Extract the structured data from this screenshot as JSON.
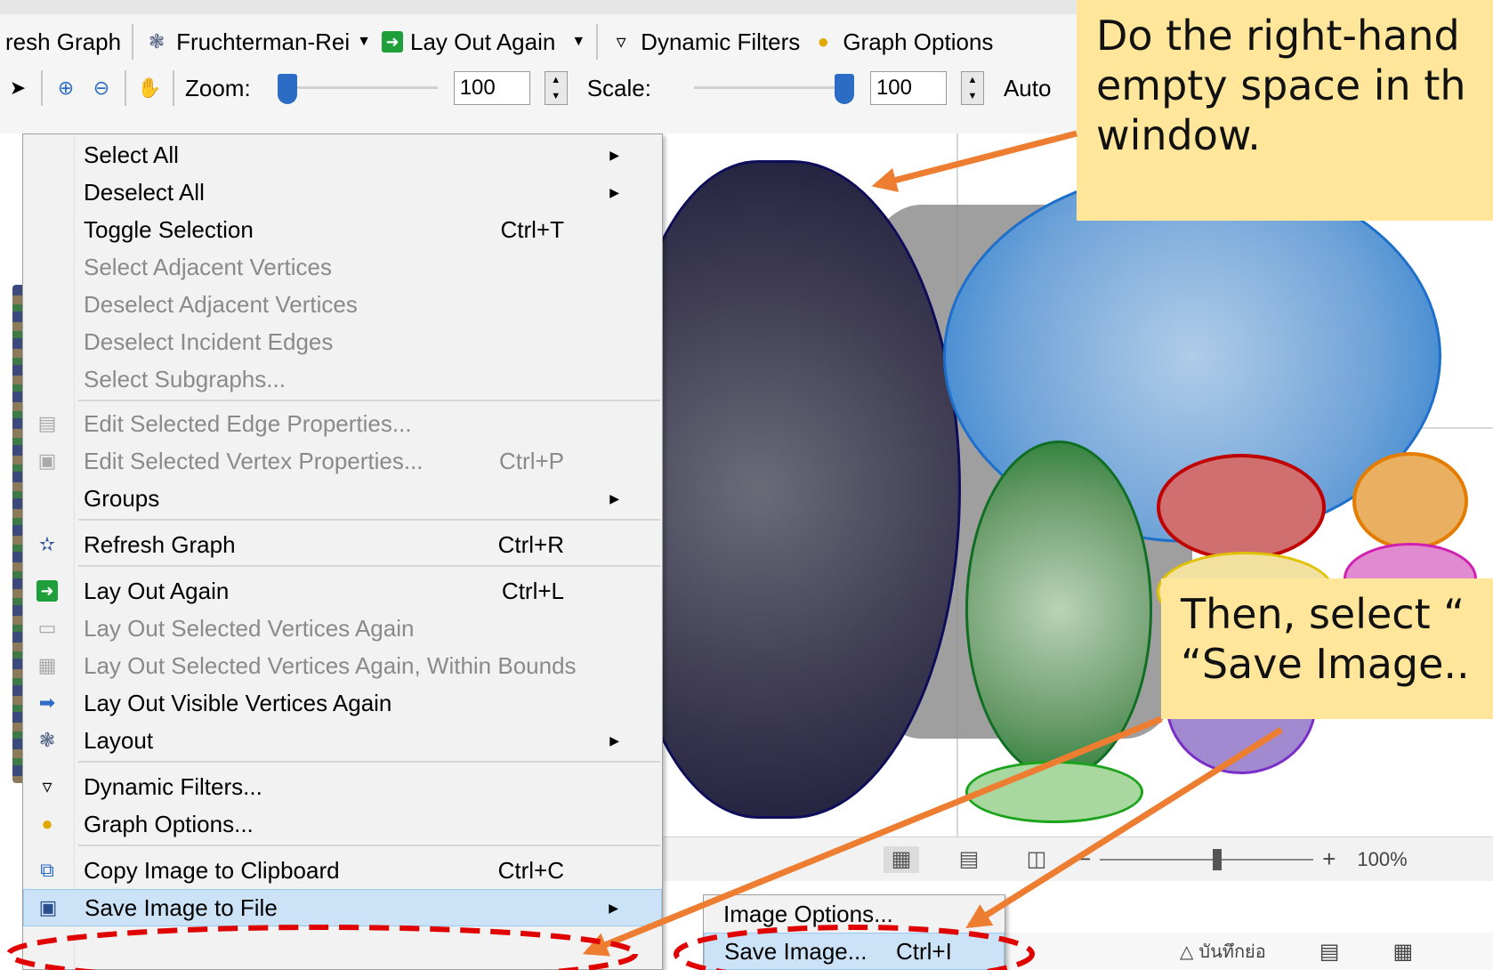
{
  "toolbar": {
    "row1": {
      "refresh_label": "resh Graph",
      "layout_select": "Fruchterman-Rei",
      "lay_out_again": "Lay Out Again",
      "dynamic_filters": "Dynamic Filters",
      "graph_options": "Graph Options"
    },
    "row2": {
      "zoom_label": "Zoom:",
      "zoom_value": "100",
      "zoom_fraction": 0.0,
      "scale_label": "Scale:",
      "scale_value": "100",
      "scale_fraction": 1.0,
      "auto_label": "Auto"
    }
  },
  "context_menu": {
    "items": [
      {
        "label": "Select All",
        "shortcut": "",
        "submenu": true,
        "disabled": false,
        "icon": ""
      },
      {
        "label": "Deselect All",
        "shortcut": "",
        "submenu": true,
        "disabled": false,
        "icon": ""
      },
      {
        "label": "Toggle Selection",
        "shortcut": "Ctrl+T",
        "submenu": false,
        "disabled": false,
        "icon": ""
      },
      {
        "label": "Select Adjacent Vertices",
        "shortcut": "",
        "submenu": false,
        "disabled": true,
        "icon": ""
      },
      {
        "label": "Deselect Adjacent Vertices",
        "shortcut": "",
        "submenu": false,
        "disabled": true,
        "icon": ""
      },
      {
        "label": "Deselect Incident Edges",
        "shortcut": "",
        "submenu": false,
        "disabled": true,
        "icon": ""
      },
      {
        "label": "Select Subgraphs...",
        "shortcut": "",
        "submenu": false,
        "disabled": true,
        "icon": ""
      },
      {
        "label": "Edit Selected Edge Properties...",
        "shortcut": "",
        "submenu": false,
        "disabled": true,
        "icon": "edge-properties-icon"
      },
      {
        "label": "Edit Selected Vertex Properties...",
        "shortcut": "Ctrl+P",
        "submenu": false,
        "disabled": true,
        "icon": "vertex-properties-icon"
      },
      {
        "label": "Groups",
        "shortcut": "",
        "submenu": true,
        "disabled": false,
        "icon": ""
      },
      {
        "label": "Refresh Graph",
        "shortcut": "Ctrl+R",
        "submenu": false,
        "disabled": false,
        "icon": "refresh-graph-icon"
      },
      {
        "label": "Lay Out Again",
        "shortcut": "Ctrl+L",
        "submenu": false,
        "disabled": false,
        "icon": "lay-out-again-icon"
      },
      {
        "label": "Lay Out Selected Vertices Again",
        "shortcut": "",
        "submenu": false,
        "disabled": true,
        "icon": "lay-out-selected-icon"
      },
      {
        "label": "Lay Out Selected Vertices Again, Within Bounds",
        "shortcut": "",
        "submenu": false,
        "disabled": true,
        "icon": "lay-out-bounds-icon"
      },
      {
        "label": "Lay Out Visible Vertices Again",
        "shortcut": "",
        "submenu": false,
        "disabled": false,
        "icon": "arrow-right-icon"
      },
      {
        "label": "Layout",
        "shortcut": "",
        "submenu": true,
        "disabled": false,
        "icon": "layout-icon"
      },
      {
        "label": "Dynamic Filters...",
        "shortcut": "",
        "submenu": false,
        "disabled": false,
        "icon": "filter-icon"
      },
      {
        "label": "Graph Options...",
        "shortcut": "",
        "submenu": false,
        "disabled": false,
        "icon": "palette-icon"
      },
      {
        "label": "Copy Image to Clipboard",
        "shortcut": "Ctrl+C",
        "submenu": false,
        "disabled": false,
        "icon": "copy-icon"
      },
      {
        "label": "Save Image to File",
        "shortcut": "",
        "submenu": true,
        "disabled": false,
        "icon": "save-icon",
        "highlighted": true
      }
    ]
  },
  "submenu": {
    "items": [
      {
        "label": "Image Options...",
        "shortcut": ""
      },
      {
        "label": "Save Image...",
        "shortcut": "Ctrl+I",
        "highlighted": true
      }
    ]
  },
  "callouts": {
    "right_click": "Do the right-hand\nempty space in th\nwindow.",
    "save_image": "Then, select “\n“Save Image.."
  },
  "statusbar": {
    "minus": "−",
    "plus": "+",
    "zoom_percent": "100%",
    "zoom_fraction": 0.55,
    "notes_label": "บันทึกย่อ"
  },
  "colors": {
    "callout_bg": "#ffe69a",
    "arrow": "#ed7d31",
    "dashed_ellipse": "#e00000",
    "menu_highlight": "#cce3f7"
  }
}
